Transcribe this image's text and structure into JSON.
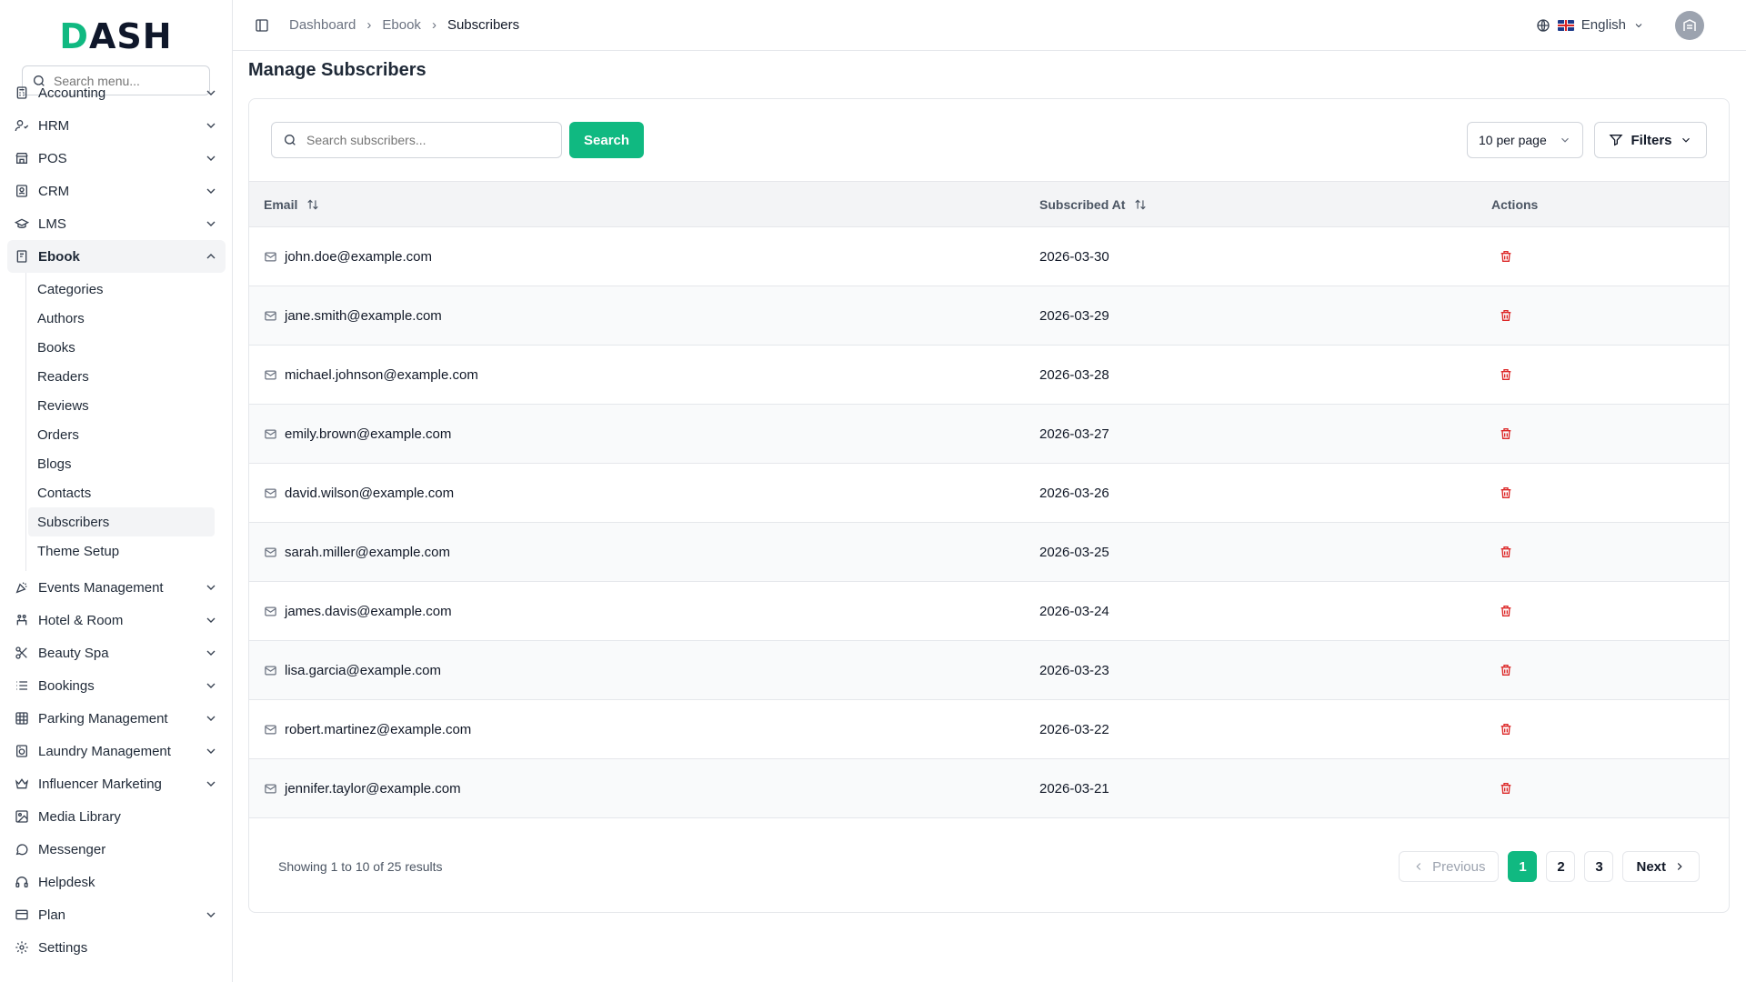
{
  "brand": {
    "logo_text": "DASH"
  },
  "sidebar": {
    "search_placeholder": "Search menu...",
    "items": [
      {
        "label": "Accounting",
        "icon": "calculator-icon"
      },
      {
        "label": "HRM",
        "icon": "users-icon"
      },
      {
        "label": "POS",
        "icon": "store-icon"
      },
      {
        "label": "CRM",
        "icon": "contact-icon"
      },
      {
        "label": "LMS",
        "icon": "graduation-cap-icon"
      },
      {
        "label": "Ebook",
        "icon": "book-icon"
      },
      {
        "label": "Events Management",
        "icon": "party-icon"
      },
      {
        "label": "Hotel & Room",
        "icon": "hotel-icon"
      },
      {
        "label": "Beauty Spa",
        "icon": "scissors-icon"
      },
      {
        "label": "Bookings",
        "icon": "list-icon"
      },
      {
        "label": "Parking Management",
        "icon": "grid-icon"
      },
      {
        "label": "Laundry Management",
        "icon": "washing-machine-icon"
      },
      {
        "label": "Influencer Marketing",
        "icon": "crown-icon"
      },
      {
        "label": "Media Library",
        "icon": "image-icon"
      },
      {
        "label": "Messenger",
        "icon": "message-icon"
      },
      {
        "label": "Helpdesk",
        "icon": "headphones-icon"
      },
      {
        "label": "Plan",
        "icon": "credit-card-icon"
      },
      {
        "label": "Settings",
        "icon": "gear-icon"
      }
    ],
    "ebook_sub": [
      "Categories",
      "Authors",
      "Books",
      "Readers",
      "Reviews",
      "Orders",
      "Blogs",
      "Contacts",
      "Subscribers",
      "Theme Setup"
    ],
    "active_sub": "Subscribers"
  },
  "header": {
    "breadcrumb": [
      "Dashboard",
      "Ebook",
      "Subscribers"
    ],
    "language": "English"
  },
  "page": {
    "title": "Manage Subscribers",
    "search_placeholder": "Search subscribers...",
    "search_button": "Search",
    "per_page": "10 per page",
    "filters_button": "Filters"
  },
  "table": {
    "columns": [
      "Email",
      "Subscribed At",
      "Actions"
    ],
    "rows": [
      {
        "email": "john.doe@example.com",
        "date": "2026-03-30"
      },
      {
        "email": "jane.smith@example.com",
        "date": "2026-03-29"
      },
      {
        "email": "michael.johnson@example.com",
        "date": "2026-03-28"
      },
      {
        "email": "emily.brown@example.com",
        "date": "2026-03-27"
      },
      {
        "email": "david.wilson@example.com",
        "date": "2026-03-26"
      },
      {
        "email": "sarah.miller@example.com",
        "date": "2026-03-25"
      },
      {
        "email": "james.davis@example.com",
        "date": "2026-03-24"
      },
      {
        "email": "lisa.garcia@example.com",
        "date": "2026-03-23"
      },
      {
        "email": "robert.martinez@example.com",
        "date": "2026-03-22"
      },
      {
        "email": "jennifer.taylor@example.com",
        "date": "2026-03-21"
      }
    ]
  },
  "pagination": {
    "summary": "Showing 1 to 10 of 25 results",
    "previous": "Previous",
    "next": "Next",
    "pages": [
      "1",
      "2",
      "3"
    ],
    "current": "1"
  },
  "colors": {
    "accent": "#10b981",
    "danger": "#dc2626"
  }
}
